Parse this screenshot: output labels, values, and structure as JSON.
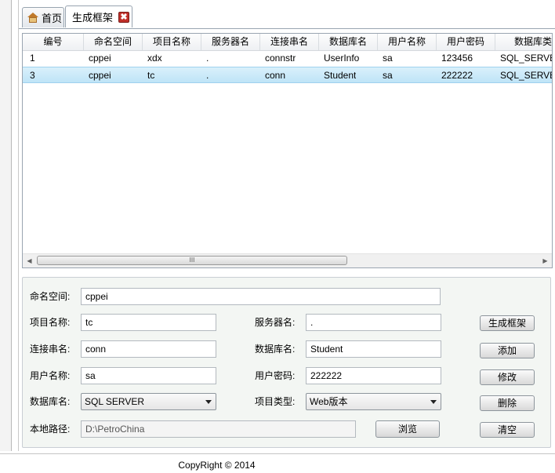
{
  "tabs": [
    {
      "label": "首页"
    },
    {
      "label": "生成框架"
    }
  ],
  "grid": {
    "columns": [
      "编号",
      "命名空间",
      "项目名称",
      "服务器名",
      "连接串名",
      "数据库名",
      "用户名称",
      "用户密码",
      "数据库类"
    ],
    "rows": [
      [
        "1",
        "cppei",
        "xdx",
        ".",
        "connstr",
        "UserInfo",
        "sa",
        "123456",
        "SQL_SERVE"
      ],
      [
        "3",
        "cppei",
        "tc",
        ".",
        "conn",
        "Student",
        "sa",
        "222222",
        "SQL_SERVE"
      ]
    ],
    "scroll_thumb": "III"
  },
  "form": {
    "namespace_label": "命名空间:",
    "namespace_value": "cppei",
    "project_label": "项目名称:",
    "project_value": "tc",
    "server_label": "服务器名:",
    "server_value": ".",
    "conn_label": "连接串名:",
    "conn_value": "conn",
    "dbname_label": "数据库名:",
    "dbname_value": "Student",
    "user_label": "用户名称:",
    "user_value": "sa",
    "password_label": "用户密码:",
    "password_value": "222222",
    "dbtype_label": "数据库名:",
    "dbtype_value": "SQL SERVER",
    "projtype_label": "项目类型:",
    "projtype_value": "Web版本",
    "path_label": "本地路径:",
    "path_value": "D:\\PetroChina",
    "browse_button": "浏览",
    "generate_button": "生成框架",
    "add_button": "添加",
    "edit_button": "修改",
    "delete_button": "删除",
    "clear_button": "清空"
  },
  "footer": {
    "text": "CopyRight © 2014"
  }
}
